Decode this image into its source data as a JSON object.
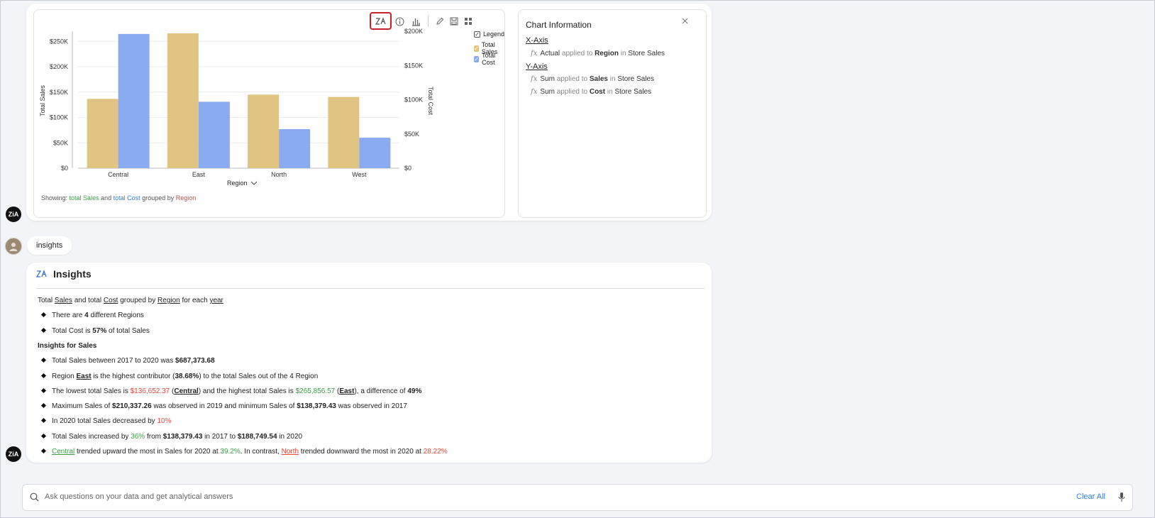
{
  "chart_card": {
    "legend_items": [
      {
        "label": "Legend",
        "color": "#ffffff",
        "checked": true
      },
      {
        "label": "Total Sales",
        "color": "#e0c582",
        "checked": true
      },
      {
        "label": "Total Cost",
        "color": "#8aabef",
        "checked": true
      }
    ],
    "showing": {
      "prefix": "Showing:",
      "part1": "total Sales",
      "and": "and",
      "part2": "total Cost",
      "grouped": "grouped by",
      "part3": "Region"
    },
    "region_dropdown": "Region"
  },
  "chart_data": {
    "type": "bar",
    "categories": [
      "Central",
      "East",
      "North",
      "West"
    ],
    "series": [
      {
        "name": "Total Sales",
        "axis": "left",
        "color": "#e0c582",
        "values": [
          136652.37,
          265856.57,
          145000,
          140500
        ]
      },
      {
        "name": "Total Cost",
        "axis": "right",
        "color": "#8aabef",
        "values": [
          196000,
          97000,
          57000,
          44500
        ]
      }
    ],
    "ylabel": "Total Sales",
    "ylabel_right": "Total Cost",
    "xlabel": "Region",
    "ylim": [
      0,
      270000
    ],
    "ylim_right": [
      0,
      200000
    ],
    "yticks": [
      "$0",
      "$50K",
      "$100K",
      "$150K",
      "$200K",
      "$250K"
    ],
    "yticks_right": [
      "$0",
      "$50K",
      "$100K",
      "$150K",
      "$200K"
    ],
    "grid": true,
    "legend": "right"
  },
  "chart_info": {
    "title": "Chart Information",
    "x_axis_label": "X-Axis",
    "x_axis": [
      {
        "fn": "Actual",
        "applied": "applied to",
        "field": "Region",
        "in": "in",
        "table": "Store Sales"
      }
    ],
    "y_axis_label": "Y-Axis",
    "y_axis": [
      {
        "fn": "Sum",
        "applied": "applied to",
        "field": "Sales",
        "in": "in",
        "table": "Store Sales"
      },
      {
        "fn": "Sum",
        "applied": "applied to",
        "field": "Cost",
        "in": "in",
        "table": "Store Sales"
      }
    ]
  },
  "user_message": "insights",
  "insights": {
    "title": "Insights",
    "summary": {
      "t1": "Total",
      "t2": "Sales",
      "t3": "and total",
      "t4": "Cost",
      "t5": "grouped by",
      "t6": "Region",
      "t7": "for each",
      "t8": "year"
    },
    "b1": {
      "a": "There are",
      "b": "4",
      "c": "different Regions"
    },
    "b2": {
      "a": "Total Cost is",
      "b": "57%",
      "c": "of total Sales"
    },
    "section": "Insights for Sales",
    "s1": {
      "a": "Total Sales between 2017 to 2020 was",
      "b": "$687,373.68"
    },
    "s2": {
      "a": "Region",
      "b": "East",
      "c": "is the highest contributor (",
      "d": "38.68%",
      "e": ") to the total Sales out of the 4 Region"
    },
    "s3": {
      "a": "The lowest total Sales is",
      "b": "$136,652.37",
      "c": "(",
      "d": "Central",
      "e": ") and the highest total Sales is",
      "f": "$265,856.57",
      "g": "(",
      "h": "East",
      "i": "), a difference of",
      "j": "49%"
    },
    "s4": {
      "a": "Maximum Sales of",
      "b": "$210,337.26",
      "c": "was observed in 2019 and minimum Sales of",
      "d": "$138,379.43",
      "e": "was observed in 2017"
    },
    "s5": {
      "a": "In 2020 total Sales decreased by",
      "b": "10%"
    },
    "s6": {
      "a": "Total Sales increased by",
      "b": "36%",
      "c": "from",
      "d": "$138,379.43",
      "e": "in 2017 to",
      "f": "$188,749.54",
      "g": "in 2020"
    },
    "s7": {
      "a": "Central",
      "b": "trended upward the most in Sales for 2020 at",
      "c": "39.2%",
      "d": ". In contrast,",
      "e": "North",
      "f": "trended downward the most in 2020 at",
      "g": "28.22%"
    }
  },
  "search": {
    "placeholder": "Ask questions on your data and get analytical answers",
    "clear_all": "Clear All"
  },
  "avatar_bot": "ZiA"
}
